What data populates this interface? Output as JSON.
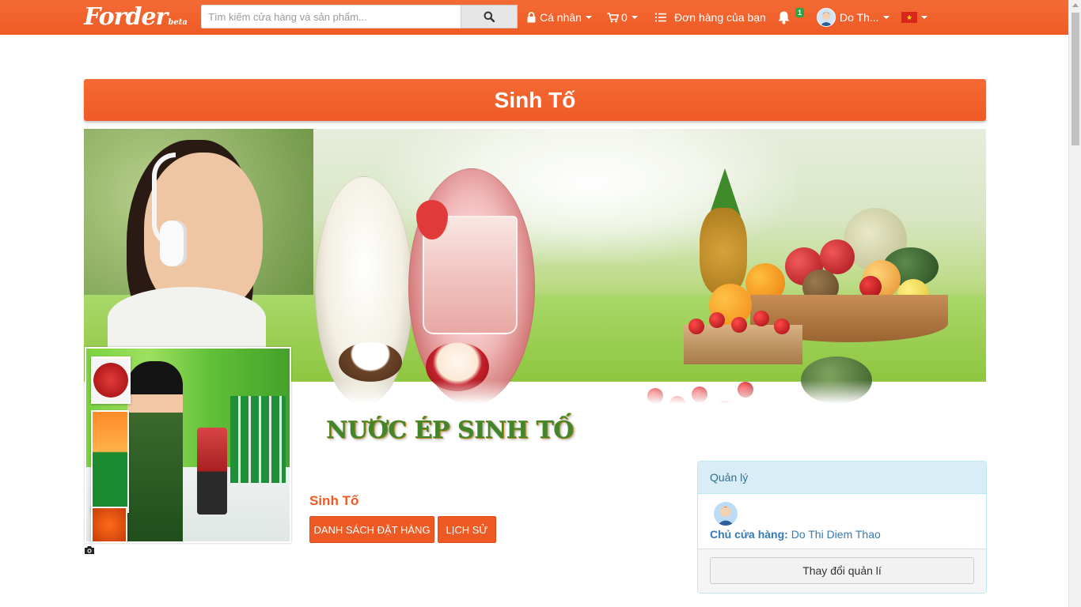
{
  "navbar": {
    "logo_text": "Forder",
    "logo_badge": "beta",
    "search": {
      "placeholder": "Tìm kiếm cửa hàng và sản phẩm..."
    },
    "personal_label": "Cá nhân",
    "cart_count": "0",
    "orders_label": "Đơn hàng của bạn",
    "notification_count": "1",
    "user_name": "Do Th...",
    "language_flag": "vietnam-flag",
    "accent_color": "#ef5a24"
  },
  "shop": {
    "title": "Sinh Tố",
    "cover_caption": "NƯỚC ÉP SINH TỐ",
    "name": "Sinh Tố",
    "orders_button": "DANH SÁCH ĐẶT HÀNG",
    "history_button": "LỊCH SỬ"
  },
  "manager_panel": {
    "heading": "Quản lý",
    "owner_label": "Chủ cửa hàng:",
    "owner_name": "Do Thi Diem Thao",
    "change_button": "Thay đổi quản lí"
  },
  "icons": [
    "search-icon",
    "lock-icon",
    "cart-icon",
    "list-icon",
    "bell-icon",
    "avatar",
    "vietnam-flag",
    "camera-icon"
  ]
}
